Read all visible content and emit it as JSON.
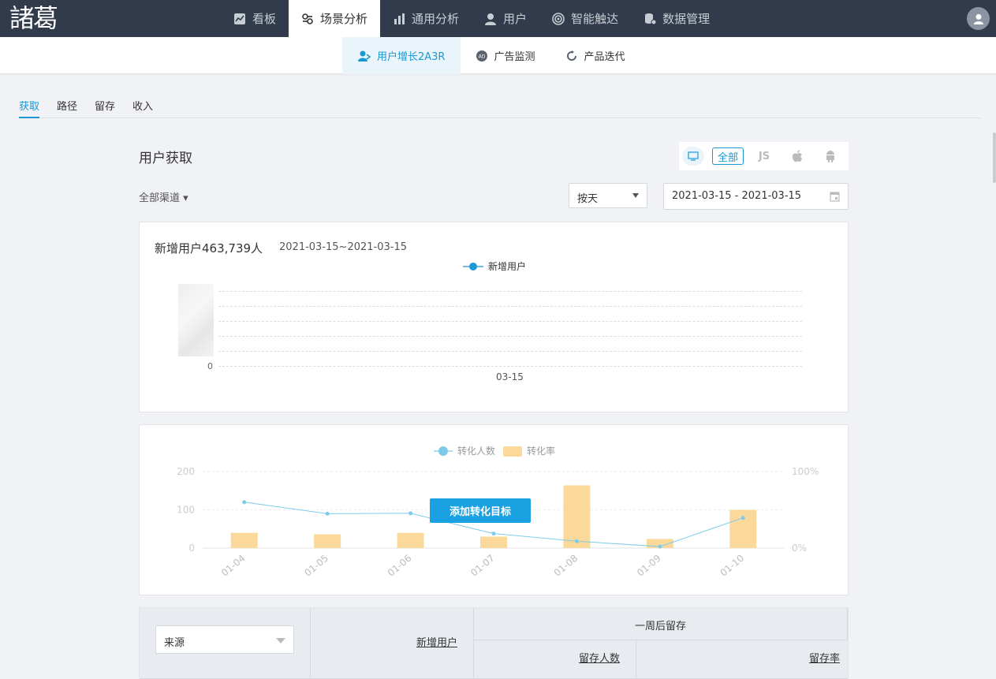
{
  "logo": "諸葛",
  "topnav": {
    "items": [
      {
        "label": "看板",
        "icon": "dashboard-icon",
        "active": false
      },
      {
        "label": "场景分析",
        "icon": "scene-icon",
        "active": true
      },
      {
        "label": "通用分析",
        "icon": "bar-chart-icon",
        "active": false
      },
      {
        "label": "用户",
        "icon": "user-icon",
        "active": false
      },
      {
        "label": "智能触达",
        "icon": "target-icon",
        "active": false
      },
      {
        "label": "数据管理",
        "icon": "database-icon",
        "active": false
      }
    ]
  },
  "subnav": {
    "items": [
      {
        "label": "用户增长2A3R",
        "icon": "user-growth-icon",
        "active": true
      },
      {
        "label": "广告监测",
        "icon": "ad-icon",
        "active": false
      },
      {
        "label": "产品迭代",
        "icon": "cycle-icon",
        "active": false
      }
    ]
  },
  "tabs": [
    "获取",
    "路径",
    "留存",
    "收入"
  ],
  "page": {
    "title": "用户获取",
    "platforms": {
      "all": "全部",
      "js": "JS"
    },
    "channel": "全部渠道 ▾",
    "granularity": "按天",
    "date_range": "2021-03-15 - 2021-03-15"
  },
  "card1": {
    "title": "新增用户463,739人",
    "date": "2021-03-15~2021-03-15",
    "legend": "新增用户",
    "y_zero": "0",
    "x_label": "03-15"
  },
  "chart_data": {
    "type": "bar",
    "categories": [
      "01-04",
      "01-05",
      "01-06",
      "01-07",
      "01-08",
      "01-09",
      "01-10"
    ],
    "series": [
      {
        "name": "转化人数",
        "type": "line",
        "axis": "left",
        "values": [
          120,
          90,
          91,
          38,
          18,
          4,
          79
        ]
      },
      {
        "name": "转化率",
        "type": "bar",
        "axis": "right",
        "values": [
          20,
          18,
          20,
          15,
          82,
          12,
          50
        ]
      }
    ],
    "left_axis": {
      "ticks": [
        "200",
        "100",
        "0"
      ],
      "ylim": [
        0,
        200
      ]
    },
    "right_axis": {
      "ticks": [
        "100%",
        "0%"
      ],
      "ylim": [
        0,
        100
      ]
    },
    "line_color": "#7ecbea",
    "bar_color": "#fad99a"
  },
  "card2": {
    "add_goal_button": "添加转化目标"
  },
  "table": {
    "source_select": "来源",
    "col_new_users": "新增用户",
    "group_week_retention": "一周后留存",
    "col_retained_users": "留存人数",
    "col_retention_rate": "留存率"
  }
}
